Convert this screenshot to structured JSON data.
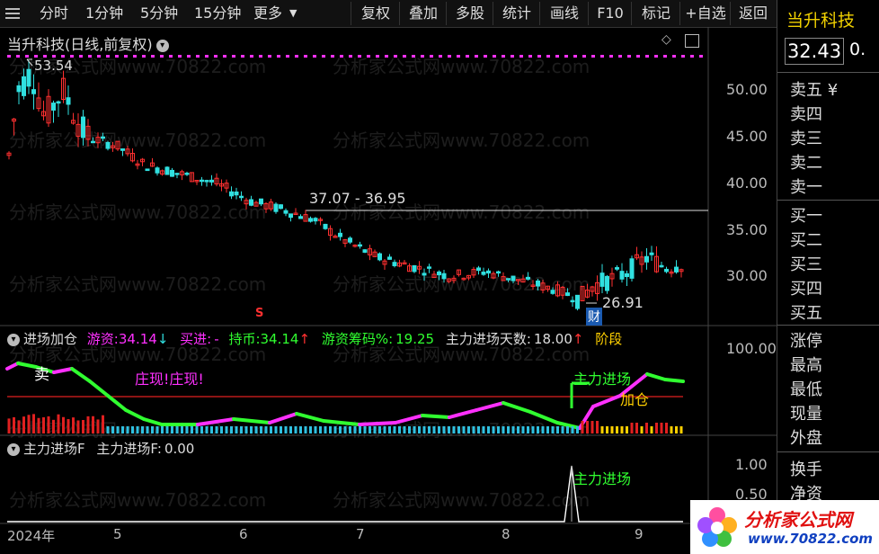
{
  "toolbar": {
    "left_items": [
      "分时",
      "1分钟",
      "5分钟",
      "15分钟",
      "更多"
    ],
    "right_items": [
      "复权",
      "叠加",
      "多股",
      "统计",
      "画线",
      "F10",
      "标记",
      "+自选",
      "返回"
    ]
  },
  "sidebar": {
    "stock_name": "当升科技",
    "price": "32.43",
    "price_extra": "0.",
    "sell_labels": [
      "卖五 ¥",
      "卖四",
      "卖三",
      "卖二",
      "卖一"
    ],
    "buy_labels": [
      "买一",
      "买二",
      "买三",
      "买四",
      "买五"
    ],
    "info_labels": [
      "涨停",
      "最高",
      "最低",
      "现量",
      "外盘"
    ],
    "bottom_labels": [
      "换手",
      "净资"
    ]
  },
  "main_chart": {
    "title": "当升科技(日线,前复权)",
    "y_ticks": [
      "50.00",
      "45.00",
      "40.00",
      "35.00",
      "30.00"
    ],
    "high_label": "53.54",
    "low_label": "26.91",
    "range_label": "37.07 - 36.95",
    "fin_badge": "财",
    "s_marker": "S"
  },
  "indicator1": {
    "name": "进场加仓",
    "youzi_label": "游资:",
    "youzi_value": "34.14",
    "youzi_arrow": "↓",
    "buy_label": "买进:",
    "buy_value": "-",
    "hold_label": "持币:",
    "hold_value": "34.14",
    "hold_arrow": "↑",
    "chip_label": "游资筹码%:",
    "chip_value": "19.25",
    "days_label": "主力进场天数:",
    "days_value": "18.00",
    "days_arrow": "↑",
    "stage_label": "阶段",
    "y_tick": "100.00",
    "sell_text": "卖",
    "zhuang_text": "庄现!庄现!",
    "zljc_text": "主力进场",
    "jiacang_text": "加仓"
  },
  "indicator2": {
    "name": "主力进场F",
    "value_label": "主力进场F:",
    "value": "0.00",
    "y_ticks": [
      "1.00",
      "0.50"
    ],
    "annotation": "主力进场"
  },
  "x_axis": {
    "labels": [
      "2024年",
      "5",
      "6",
      "7",
      "8",
      "9"
    ]
  },
  "watermark": {
    "text": "分析家公式网www.70822.com"
  },
  "logo": {
    "title": "分析家公式网",
    "url": "www.70822.com"
  },
  "colors": {
    "up": "#ff3030",
    "down": "#30e0e0",
    "bg": "#000000",
    "magenta": "#ff30ff",
    "green": "#30ff30",
    "yellow": "#ffd000"
  }
}
